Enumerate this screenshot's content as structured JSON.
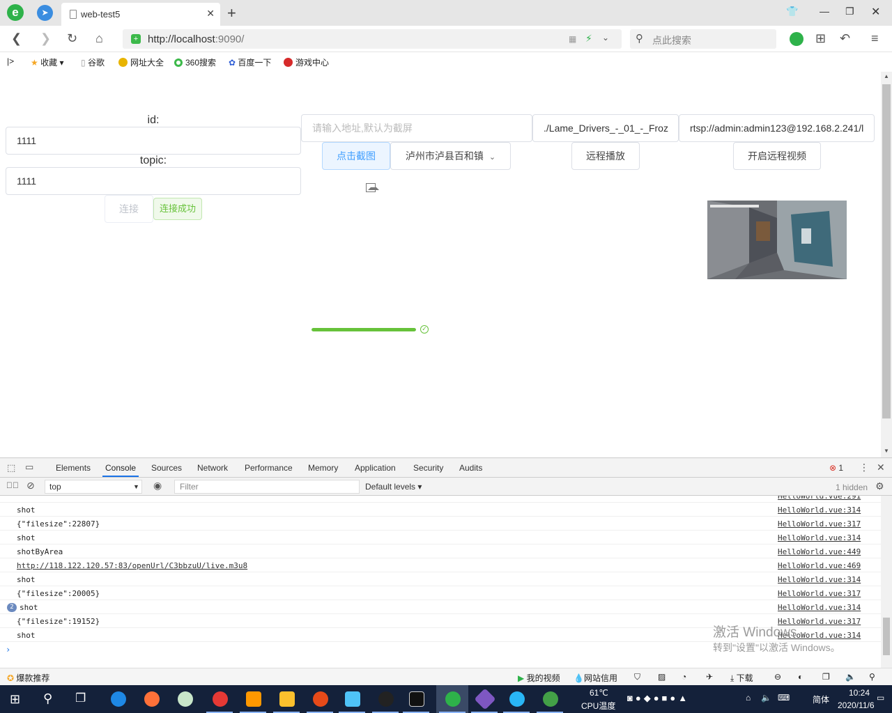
{
  "browser": {
    "tab_title": "web-test5",
    "url_host": "http://localhost",
    "url_rest": ":9090/",
    "search_placeholder": "点此搜索",
    "bookmarks": [
      "收藏",
      "谷歌",
      "网址大全",
      "360搜索",
      "百度一下",
      "游戏中心"
    ]
  },
  "form": {
    "id_label": "id:",
    "id_value": "1111",
    "topic_label": "topic:",
    "topic_value": "1111",
    "connect_label": "连接",
    "connected_label": "连接成功",
    "address_placeholder": "请输入地址,默认为截屏",
    "file_value": "./Lame_Drivers_-_01_-_Froz",
    "rtsp_value": "rtsp://admin:admin123@192.168.2.241/l",
    "capture_button": "点击截图",
    "location_select": "泸州市泸县百和镇",
    "remote_play_button": "远程播放",
    "remote_video_button": "开启远程视频",
    "progress": 1.0
  },
  "devtools": {
    "tabs": [
      "Elements",
      "Console",
      "Sources",
      "Network",
      "Performance",
      "Memory",
      "Application",
      "Security",
      "Audits"
    ],
    "active_tab": "Console",
    "error_count": "1",
    "context": "top",
    "filter_placeholder": "Filter",
    "levels": "Default levels",
    "hidden": "1 hidden",
    "rows": [
      {
        "msg": "shot",
        "src": "HelloWorld.vue:314"
      },
      {
        "msg": "{\"filesize\":22807}",
        "src": "HelloWorld.vue:317"
      },
      {
        "msg": "shot",
        "src": "HelloWorld.vue:314"
      },
      {
        "msg": "shotByArea",
        "src": "HelloWorld.vue:449"
      },
      {
        "msg": "http://118.122.120.57:83/openUrl/C3bbzuU/live.m3u8",
        "src": "HelloWorld.vue:469",
        "link": true
      },
      {
        "msg": "shot",
        "src": "HelloWorld.vue:314"
      },
      {
        "msg": "{\"filesize\":20005}",
        "src": "HelloWorld.vue:317"
      },
      {
        "msg": "shot",
        "src": "HelloWorld.vue:314",
        "count": "2"
      },
      {
        "msg": "{\"filesize\":19152}",
        "src": "HelloWorld.vue:317"
      },
      {
        "msg": "shot",
        "src": "HelloWorld.vue:314"
      }
    ],
    "watermark_title": "激活 Windows",
    "watermark_sub": "转到\"设置\"以激活 Windows。"
  },
  "statusbar": {
    "left": "爆款推荐",
    "my_video": "我的视频",
    "credit": "网站信用",
    "download": "下载"
  },
  "taskbar": {
    "temp": "61℃",
    "cpu": "CPU温度",
    "ime": "简体",
    "time": "10:24",
    "date": "2020/11/6"
  }
}
